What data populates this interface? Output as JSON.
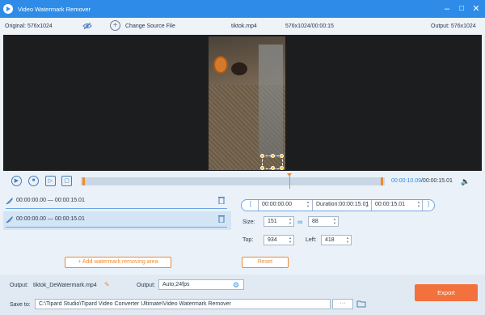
{
  "window": {
    "title": "Video Watermark Remover",
    "minimize_glyph": "–",
    "restore_glyph": "□",
    "close_glyph": "✕"
  },
  "info": {
    "original": "Original: 576x1024",
    "change_source": "Change Source File",
    "filename": "tiktok.mp4",
    "meta": "576x1024/00:00:15",
    "output": "Output: 576x1024"
  },
  "player": {
    "current_time": "00:00:10.09",
    "total_time": "/00:00:15.01"
  },
  "segments": [
    {
      "range": "00:00:00.00 — 00:00:15.01"
    },
    {
      "range": "00:00:00.00 — 00:00:15.01"
    }
  ],
  "add_area_label": "+ Add watermark removing area",
  "range_editor": {
    "open_bracket": "[",
    "close_bracket": "]",
    "start": "00:00:00.00",
    "duration": "Duration:00:00:15.01",
    "end": "00:00:15.01"
  },
  "size": {
    "label": "Size:",
    "width": "151",
    "height": "88"
  },
  "position": {
    "top_label": "Top:",
    "top": "934",
    "left_label": "Left:",
    "left": "418"
  },
  "reset_label": "Reset",
  "output_file": {
    "label": "Output:",
    "name": "tiktok_DeWatermark.mp4"
  },
  "output_format": {
    "label": "Output:",
    "value": "Auto;24fps"
  },
  "save_to": {
    "label": "Save to:",
    "path": "C:\\Tipard Studio\\Tipard Video Converter Ultimate\\Video Watermark Remover",
    "browse": "···"
  },
  "export_label": "Export",
  "colors": {
    "accent": "#2e8ce8",
    "orange": "#ef8a2e",
    "export": "#f2713c"
  }
}
